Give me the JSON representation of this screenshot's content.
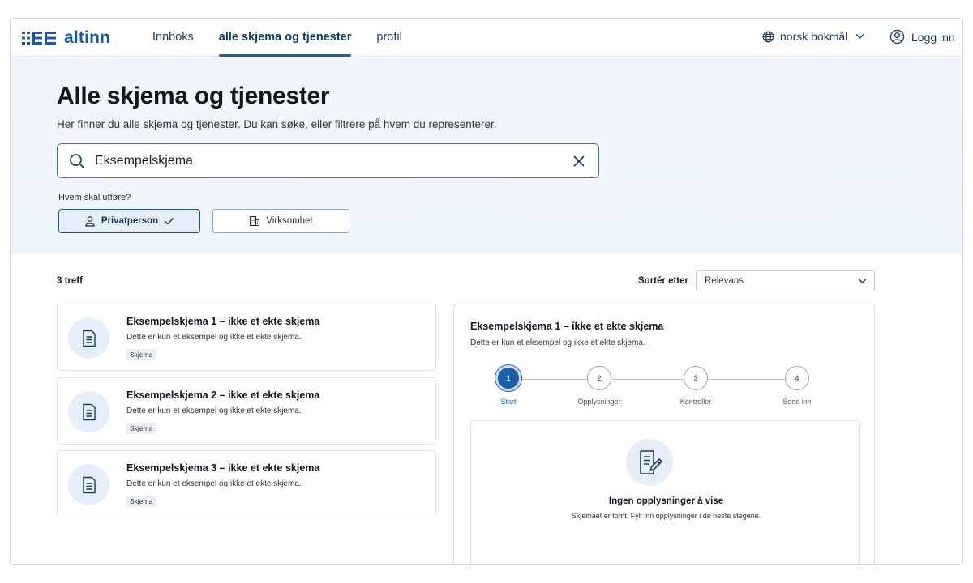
{
  "header": {
    "logo_text": "altinn",
    "nav": [
      {
        "label": "Innboks",
        "active": false
      },
      {
        "label": "alle skjema og tjenester",
        "active": true
      },
      {
        "label": "profil",
        "active": false
      }
    ],
    "language": "norsk bokmål",
    "login": "Logg inn"
  },
  "hero": {
    "title": "Alle skjema og tjenester",
    "subtitle": "Her finner du alle skjema og tjenester. Du kan søke, eller filtrere på hvem du representerer.",
    "search_value": "Eksempelskjema",
    "who_label": "Hvem skal utføre?",
    "chips": [
      {
        "label": "Privatperson",
        "selected": true,
        "icon": "person-icon"
      },
      {
        "label": "Virksomhet",
        "selected": false,
        "icon": "building-icon"
      }
    ]
  },
  "results": {
    "count": "3 treff",
    "sort_label": "Sortér etter",
    "sort_value": "Relevans",
    "cards": [
      {
        "title": "Eksempelskjema 1 – ikke et ekte skjema",
        "desc": "Dette er kun et eksempel og ikke et ekte skjema.",
        "tag": "Skjema"
      },
      {
        "title": "Eksempelskjema 2 – ikke et ekte skjema",
        "desc": "Dette er kun et eksempel og ikke et ekte skjema.",
        "tag": "Skjema"
      },
      {
        "title": "Eksempelskjema 3 – ikke et ekte skjema",
        "desc": "Dette er kun et eksempel og ikke et ekte skjema.",
        "tag": "Skjema"
      }
    ]
  },
  "detail": {
    "title": "Eksempelskjema 1 – ikke et ekte skjema",
    "desc": "Dette er kun et eksempel og ikke et ekte skjema.",
    "steps": [
      {
        "num": "1",
        "label": "Start",
        "active": true
      },
      {
        "num": "2",
        "label": "Opplysninger",
        "active": false
      },
      {
        "num": "3",
        "label": "Kontroller",
        "active": false
      },
      {
        "num": "4",
        "label": "Send inn",
        "active": false
      }
    ],
    "empty_title": "Ingen opplysninger å vise",
    "empty_sub": "Skjemaet er tomt. Fyll inn opplysninger i de neste stegene."
  },
  "colors": {
    "brand": "#1a5ba6",
    "accent": "#1f5fa8",
    "hero_bg": "#eef4fb"
  }
}
